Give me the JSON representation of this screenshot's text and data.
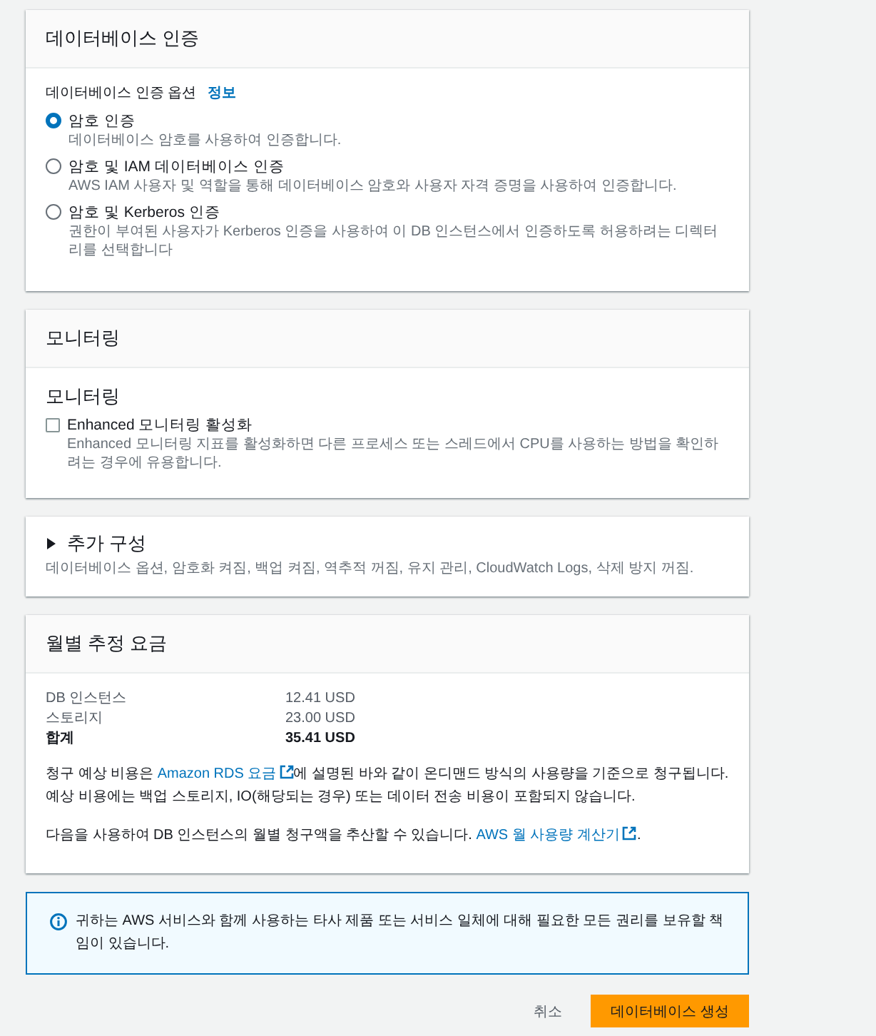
{
  "auth_section": {
    "title": "데이터베이스 인증",
    "field_label": "데이터베이스 인증 옵션",
    "info_link": "정보",
    "options": [
      {
        "label": "암호 인증",
        "description": "데이터베이스 암호를 사용하여 인증합니다.",
        "selected": true
      },
      {
        "label": "암호 및 IAM 데이터베이스 인증",
        "description": "AWS IAM 사용자 및 역할을 통해 데이터베이스 암호와 사용자 자격 증명을 사용하여 인증합니다.",
        "selected": false
      },
      {
        "label": "암호 및 Kerberos 인증",
        "description": "권한이 부여된 사용자가 Kerberos 인증을 사용하여 이 DB 인스턴스에서 인증하도록 허용하려는 디렉터리를 선택합니다",
        "selected": false
      }
    ]
  },
  "monitoring_section": {
    "title": "모니터링",
    "subtitle": "모니터링",
    "option": {
      "label": "Enhanced 모니터링 활성화",
      "description": "Enhanced 모니터링 지표를 활성화하면 다른 프로세스 또는 스레드에서 CPU를 사용하는 방법을 확인하려는 경우에 유용합니다.",
      "checked": false
    }
  },
  "additional_configuration": {
    "title": "추가 구성",
    "expanded": false,
    "summary": "데이터베이스 옵션, 암호화 켜짐, 백업 켜짐, 역추적 꺼짐, 유지 관리, CloudWatch Logs, 삭제 방지 꺼짐."
  },
  "estimated_monthly_cost": {
    "title": "월별 추정 요금",
    "rows": [
      {
        "label": "DB 인스턴스",
        "value": "12.41 USD",
        "kind": "item"
      },
      {
        "label": "스토리지",
        "value": "23.00 USD",
        "kind": "item"
      },
      {
        "label": "합계",
        "value": "35.41 USD",
        "kind": "total"
      }
    ],
    "notes": [
      {
        "before": "청구 예상 비용은 ",
        "link": "Amazon RDS 요금",
        "after": "에 설명된 바와 같이 온디맨드 방식의 사용량을 기준으로 청구됩니다. 예상 비용에는 백업 스토리지, IO(해당되는 경우) 또는 데이터 전송 비용이 포함되지 않습니다."
      },
      {
        "before": "다음을 사용하여 DB 인스턴스의 월별 청구액을 추산할 수 있습니다. ",
        "link": "AWS 월 사용량 계산기",
        "after": "."
      }
    ]
  },
  "info_alert": {
    "text": "귀하는 AWS 서비스와 함께 사용하는 타사 제품 또는 서비스 일체에 대해 필요한 모든 권리를 보유할 책임이 있습니다."
  },
  "buttons": [
    {
      "label": "취소",
      "kind": "link"
    },
    {
      "label": "데이터베이스 생성",
      "kind": "primary"
    }
  ]
}
